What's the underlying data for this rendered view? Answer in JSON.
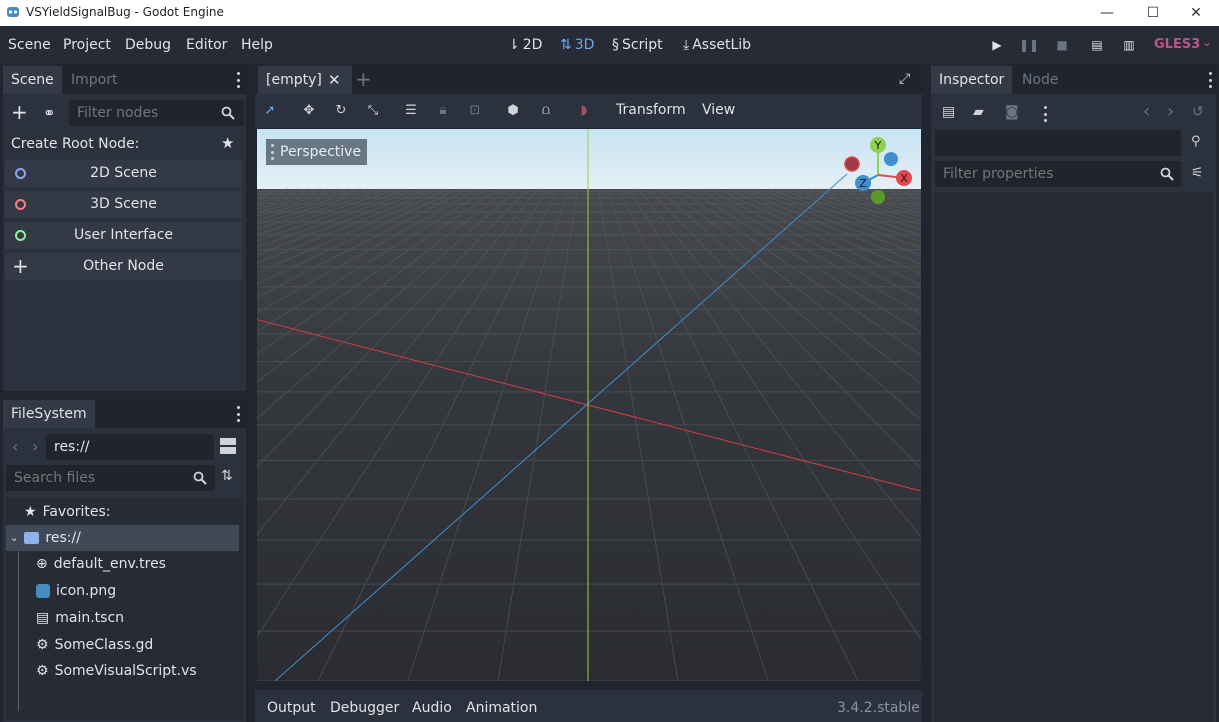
{
  "window": {
    "title": "VSYieldSignalBug - Godot Engine",
    "minimize": "—",
    "maximize": "☐",
    "close": "✕"
  },
  "menu": {
    "items": [
      "Scene",
      "Project",
      "Debug",
      "Editor",
      "Help"
    ]
  },
  "modes": {
    "d2": "2D",
    "d3": "3D",
    "script": "Script",
    "assetlib": "AssetLib",
    "active": "3D"
  },
  "renderer": "GLES3",
  "scene_dock": {
    "tabs": [
      "Scene",
      "Import"
    ],
    "filter_placeholder": "Filter nodes",
    "create_root_label": "Create Root Node:",
    "root_buttons": [
      {
        "label": "2D Scene",
        "color": "#8da5f3"
      },
      {
        "label": "3D Scene",
        "color": "#fc7f7f"
      },
      {
        "label": "User Interface",
        "color": "#8eef97"
      },
      {
        "label": "Other Node",
        "color": "#e0e0e0"
      }
    ]
  },
  "filesystem": {
    "tab": "FileSystem",
    "path": "res://",
    "search_placeholder": "Search files",
    "favorites": "Favorites:",
    "root": "res://",
    "files": [
      "default_env.tres",
      "icon.png",
      "main.tscn",
      "SomeClass.gd",
      "SomeVisualScript.vs"
    ]
  },
  "editor": {
    "tab": "[empty]",
    "menus": [
      "Transform",
      "View"
    ],
    "perspective": "Perspective",
    "gizmo": {
      "x": "X",
      "y": "Y",
      "z": "Z"
    }
  },
  "bottom": {
    "tabs": [
      "Output",
      "Debugger",
      "Audio",
      "Animation"
    ],
    "version": "3.4.2.stable"
  },
  "inspector": {
    "tabs": [
      "Inspector",
      "Node"
    ],
    "filter_placeholder": "Filter properties"
  },
  "colors": {
    "accent": "#6da8f0",
    "x_axis": "#e0474f",
    "y_axis": "#8fd14f",
    "z_axis": "#3e8ed0",
    "gles3": "#c2528b"
  }
}
